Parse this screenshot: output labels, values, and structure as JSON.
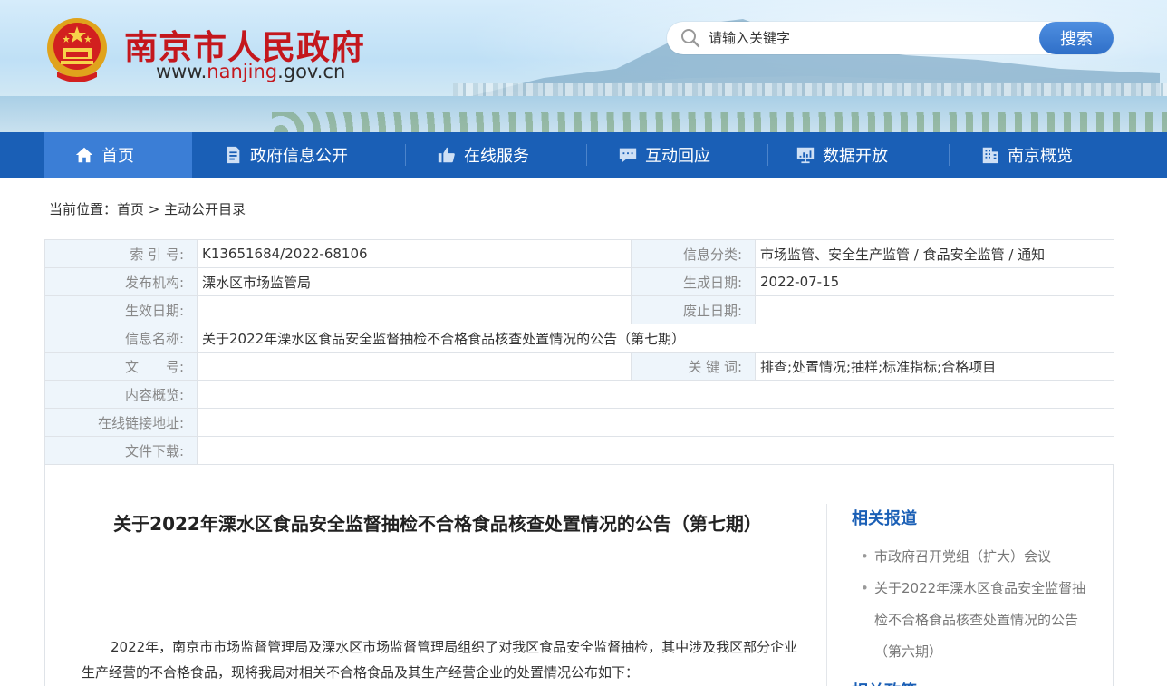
{
  "header": {
    "title": "南京市人民政府",
    "url_prefix": "www.",
    "url_highlight": "nanjing",
    "url_suffix": ".gov.cn",
    "search_placeholder": "请输入关键字",
    "search_button": "搜索"
  },
  "nav": {
    "items": [
      {
        "label": "首页",
        "icon": "home-icon"
      },
      {
        "label": "政府信息公开",
        "icon": "document-icon"
      },
      {
        "label": "在线服务",
        "icon": "thumbs-up-icon"
      },
      {
        "label": "互动回应",
        "icon": "chat-icon"
      },
      {
        "label": "数据开放",
        "icon": "chart-icon"
      },
      {
        "label": "南京概览",
        "icon": "building-icon"
      }
    ]
  },
  "breadcrumb": {
    "prefix": "当前位置：",
    "home": "首页",
    "sep": " > ",
    "current": "主动公开目录"
  },
  "info": {
    "index_label": "索 引 号:",
    "index_value": "K13651684/2022-68106",
    "category_label": "信息分类:",
    "category_value": "市场监管、安全生产监管 / 食品安全监管 / 通知",
    "org_label": "发布机构:",
    "org_value": "溧水区市场监管局",
    "created_label": "生成日期:",
    "created_value": "2022-07-15",
    "effective_label": "生效日期:",
    "effective_value": "",
    "abolish_label": "废止日期:",
    "abolish_value": "",
    "name_label": "信息名称:",
    "name_value": "关于2022年溧水区食品安全监督抽检不合格食品核查处置情况的公告（第七期）",
    "docno_label": "文　　号:",
    "docno_value": "",
    "keywords_label": "关 键 词:",
    "keywords_value": "排查;处置情况;抽样;标准指标;合格项目",
    "summary_label": "内容概览:",
    "summary_value": "",
    "link_label": "在线链接地址:",
    "link_value": "",
    "download_label": "文件下载:",
    "download_value": ""
  },
  "article": {
    "title": "关于2022年溧水区食品安全监督抽检不合格食品核查处置情况的公告（第七期）",
    "body": "2022年，南京市市场监督管理局及溧水区市场监督管理局组织了对我区食品安全监督抽检，其中涉及我区部分企业生产经营的不合格食品，现将我局对相关不合格食品及其生产经营企业的处置情况公布如下："
  },
  "sidebar": {
    "title": "相关报道",
    "items": [
      "市政府召开党组（扩大）会议",
      "关于2022年溧水区食品安全监督抽检不合格食品核查处置情况的公告（第六期）"
    ],
    "title2": "相关政策"
  }
}
